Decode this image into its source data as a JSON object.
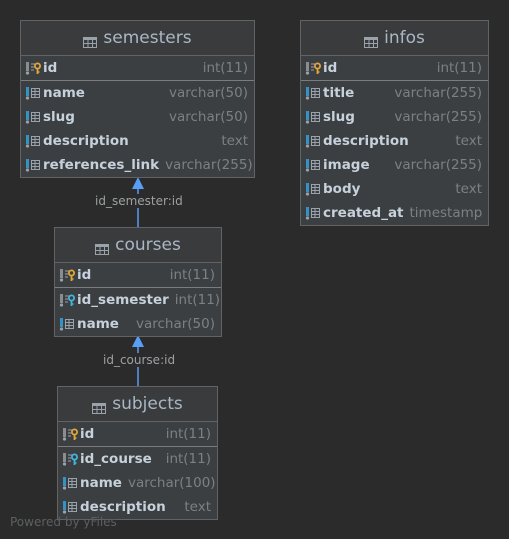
{
  "colors": {
    "background": "#2b2b2b",
    "node_fill": "#3c3f41",
    "node_border": "#616365",
    "edge": "#589df6",
    "pk_key": "#e0a53b",
    "fk_key": "#40b6e0",
    "column_marker": "#3592c4"
  },
  "tables": {
    "semesters": {
      "title": "semesters",
      "icon": "table-icon",
      "primary": [
        {
          "name": "id",
          "type": "int(11)",
          "icon": "primary-key-icon"
        }
      ],
      "columns": [
        {
          "name": "name",
          "type": "varchar(50)",
          "icon": "column-icon"
        },
        {
          "name": "slug",
          "type": "varchar(50)",
          "icon": "column-icon"
        },
        {
          "name": "description",
          "type": "text",
          "icon": "column-icon"
        },
        {
          "name": "references_link",
          "type": "varchar(255)",
          "icon": "column-icon"
        }
      ]
    },
    "infos": {
      "title": "infos",
      "icon": "table-icon",
      "primary": [
        {
          "name": "id",
          "type": "int(11)",
          "icon": "primary-key-icon"
        }
      ],
      "columns": [
        {
          "name": "title",
          "type": "varchar(255)",
          "icon": "column-icon"
        },
        {
          "name": "slug",
          "type": "varchar(255)",
          "icon": "column-icon"
        },
        {
          "name": "description",
          "type": "text",
          "icon": "column-icon"
        },
        {
          "name": "image",
          "type": "varchar(255)",
          "icon": "column-icon"
        },
        {
          "name": "body",
          "type": "text",
          "icon": "column-icon"
        },
        {
          "name": "created_at",
          "type": "timestamp",
          "icon": "column-icon"
        }
      ]
    },
    "courses": {
      "title": "courses",
      "icon": "table-icon",
      "primary": [
        {
          "name": "id",
          "type": "int(11)",
          "icon": "primary-key-icon"
        }
      ],
      "columns": [
        {
          "name": "id_semester",
          "type": "int(11)",
          "icon": "foreign-key-icon"
        },
        {
          "name": "name",
          "type": "varchar(50)",
          "icon": "column-icon"
        }
      ]
    },
    "subjects": {
      "title": "subjects",
      "icon": "table-icon",
      "primary": [
        {
          "name": "id",
          "type": "int(11)",
          "icon": "primary-key-icon"
        }
      ],
      "columns": [
        {
          "name": "id_course",
          "type": "int(11)",
          "icon": "foreign-key-icon"
        },
        {
          "name": "name",
          "type": "varchar(100)",
          "icon": "column-icon"
        },
        {
          "name": "description",
          "type": "text",
          "icon": "column-icon"
        }
      ]
    }
  },
  "relations": [
    {
      "from": "courses",
      "to": "semesters",
      "label": "id_semester:id"
    },
    {
      "from": "subjects",
      "to": "courses",
      "label": "id_course:id"
    }
  ],
  "watermark": "Powered by yFiles"
}
